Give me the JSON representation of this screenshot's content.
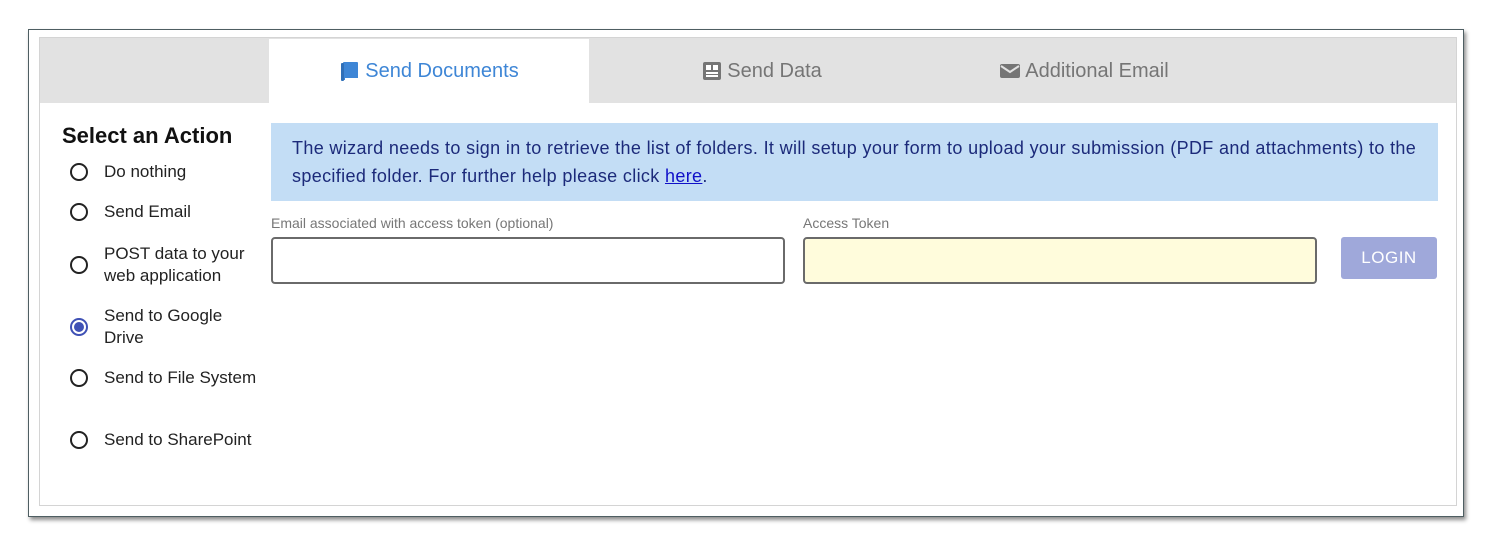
{
  "tabs": [
    {
      "label": "Send Documents",
      "icon": "book-icon",
      "active": true
    },
    {
      "label": "Send Data",
      "icon": "table-icon",
      "active": false
    },
    {
      "label": "Additional Email",
      "icon": "envelope-icon",
      "active": false
    }
  ],
  "sidebar": {
    "title": "Select an Action",
    "options": [
      {
        "label": "Do nothing",
        "checked": false
      },
      {
        "label": "Send Email",
        "checked": false
      },
      {
        "label": "POST data to your web application",
        "checked": false
      },
      {
        "label": "Send to Google Drive",
        "checked": true
      },
      {
        "label": "Send to File System",
        "checked": false
      },
      {
        "label": "Send to SharePoint",
        "checked": false
      }
    ]
  },
  "info": {
    "text": "The wizard needs to sign in to retrieve the list of folders. It will setup your form to upload your submission (PDF and attachments) to the specified folder. For further help please click ",
    "link_text": "here",
    "suffix": "."
  },
  "form": {
    "email_label": "Email associated with access token (optional)",
    "email_value": "",
    "email_placeholder": "",
    "token_label": "Access Token",
    "token_value": "",
    "token_placeholder": "",
    "login_label": "LOGIN"
  },
  "colors": {
    "accent": "#3e86d6",
    "radio_checked": "#3f51b5",
    "info_background": "#c3ddf5",
    "login_button": "#9fa8da",
    "token_background": "#fffcdc"
  }
}
